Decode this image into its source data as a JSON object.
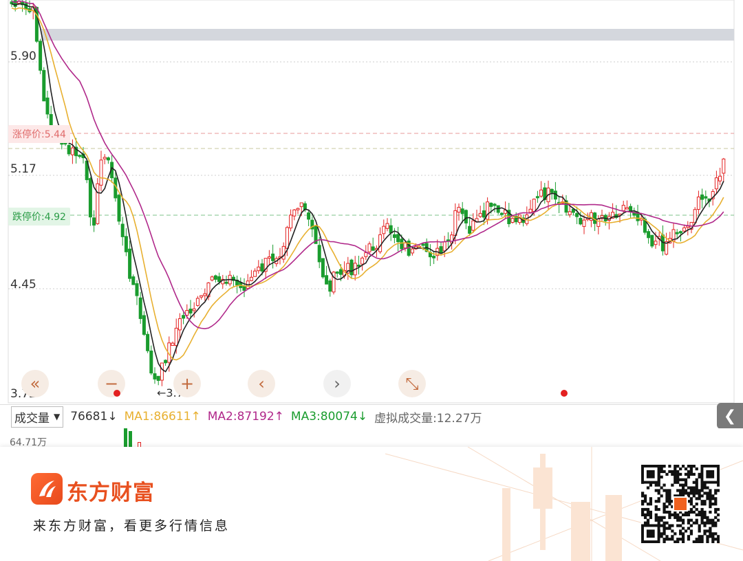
{
  "price_axis": {
    "labels": [
      "5.90",
      "5.17",
      "4.45",
      "3.72"
    ]
  },
  "limit_up": {
    "label": "涨停价:5.44"
  },
  "limit_down": {
    "label": "跌停价:4.92"
  },
  "min_price_marker": "←3.72",
  "controls": {
    "rewind": "«",
    "zoom_out": "−",
    "zoom_in": "+",
    "prev": "‹",
    "next": "›",
    "fullscreen": "⤡"
  },
  "volume_bar": {
    "indicator": "成交量",
    "vol": "76681↓",
    "ma1": "MA1:86611↑",
    "ma2": "MA2:87192↑",
    "ma3": "MA3:80074↓",
    "virtual": "虚拟成交量:12.27万",
    "scale": "64.71万"
  },
  "colors": {
    "up": "#e32020",
    "down": "#1a9c2e",
    "ma_short": "#222222",
    "ma_mid": "#e8b030",
    "ma_long": "#b0288a",
    "brand": "#e8501f"
  },
  "footer": {
    "brand": "东方财富",
    "tagline": "来东方财富，看更多行情信息"
  },
  "icons": [
    "double-left-icon",
    "minus-icon",
    "plus-icon",
    "chevron-left-icon",
    "chevron-right-icon",
    "expand-icon",
    "chevron-down-icon",
    "collapse-left-icon",
    "logo-icon",
    "qr-code"
  ]
}
